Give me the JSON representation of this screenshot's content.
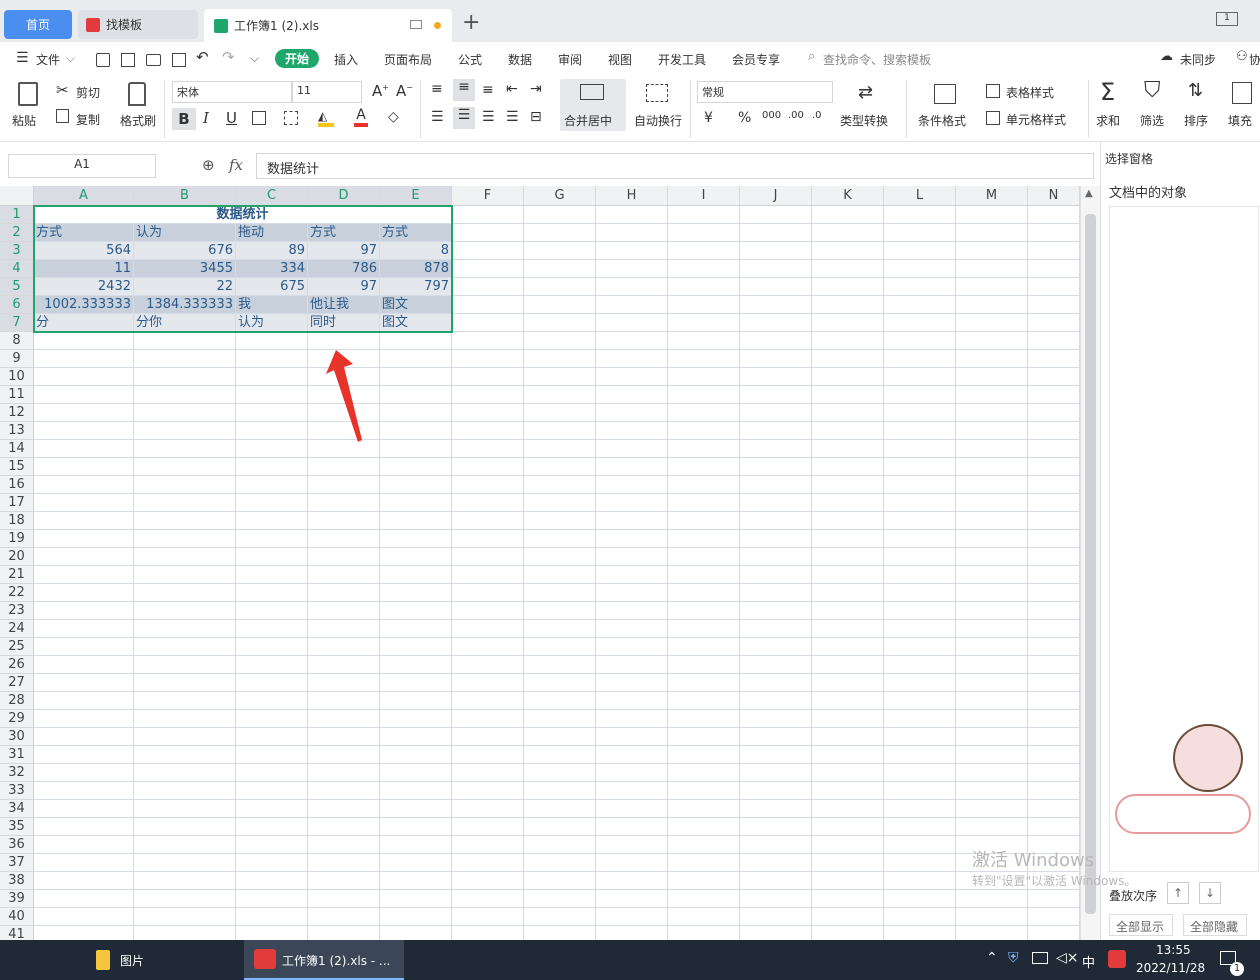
{
  "tabs": {
    "home": "首页",
    "template": "找模板",
    "doc": "工作簿1 (2).xls"
  },
  "menu": {
    "file": "文件",
    "items": [
      "开始",
      "插入",
      "页面布局",
      "公式",
      "数据",
      "审阅",
      "视图",
      "开发工具",
      "会员专享"
    ],
    "search": "查找命令、搜索模板",
    "sync": "未同步",
    "collab": "协"
  },
  "ribbon": {
    "paste": "粘贴",
    "cut": "剪切",
    "copy": "复制",
    "format_painter": "格式刷",
    "font_name": "宋体",
    "font_size": "11",
    "merge": "合并居中",
    "wrap": "自动换行",
    "number_format": "常规",
    "type_convert": "类型转换",
    "cond_format": "条件格式",
    "table_style": "表格样式",
    "cell_style": "单元格样式",
    "sum": "求和",
    "filter": "筛选",
    "sort": "排序",
    "fill": "填充",
    "currency": "¥",
    "percent": "%"
  },
  "formula": {
    "cell_ref": "A1",
    "fx": "fx",
    "content": "数据统计"
  },
  "columns": [
    "A",
    "B",
    "C",
    "D",
    "E",
    "F",
    "G",
    "H",
    "I",
    "J",
    "K",
    "L",
    "M",
    "N"
  ],
  "sheet": {
    "title": "数据统计",
    "rows": [
      [
        "方式",
        "认为",
        "拖动",
        "方式",
        "方式"
      ],
      [
        "564",
        "676",
        "89",
        "97",
        "8"
      ],
      [
        "11",
        "3455",
        "334",
        "786",
        "878"
      ],
      [
        "2432",
        "22",
        "675",
        "97",
        "797"
      ],
      [
        "1002.333333",
        "1384.333333",
        "我",
        "他让我",
        "图文"
      ],
      [
        "分",
        "分你",
        "认为",
        "同时",
        "图文"
      ]
    ]
  },
  "rightpane": {
    "select_pane": "选择窗格",
    "objects": "文档中的对象",
    "order": "叠放次序",
    "show_all": "全部显示",
    "hide_all": "全部隐藏"
  },
  "watermark": {
    "line1": "激活 Windows",
    "line2": "转到\"设置\"以激活 Windows。"
  },
  "taskbar": {
    "app1": "图片",
    "app2": "工作簿1 (2).xls - ...",
    "time": "13:55",
    "date": "2022/11/28",
    "ime": "中",
    "notif_count": "1"
  },
  "colors": {
    "accent": "#21a36b",
    "tab_blue": "#4a8ef0",
    "cell_text": "#2b5a8a",
    "arrow": "#e8332a"
  }
}
